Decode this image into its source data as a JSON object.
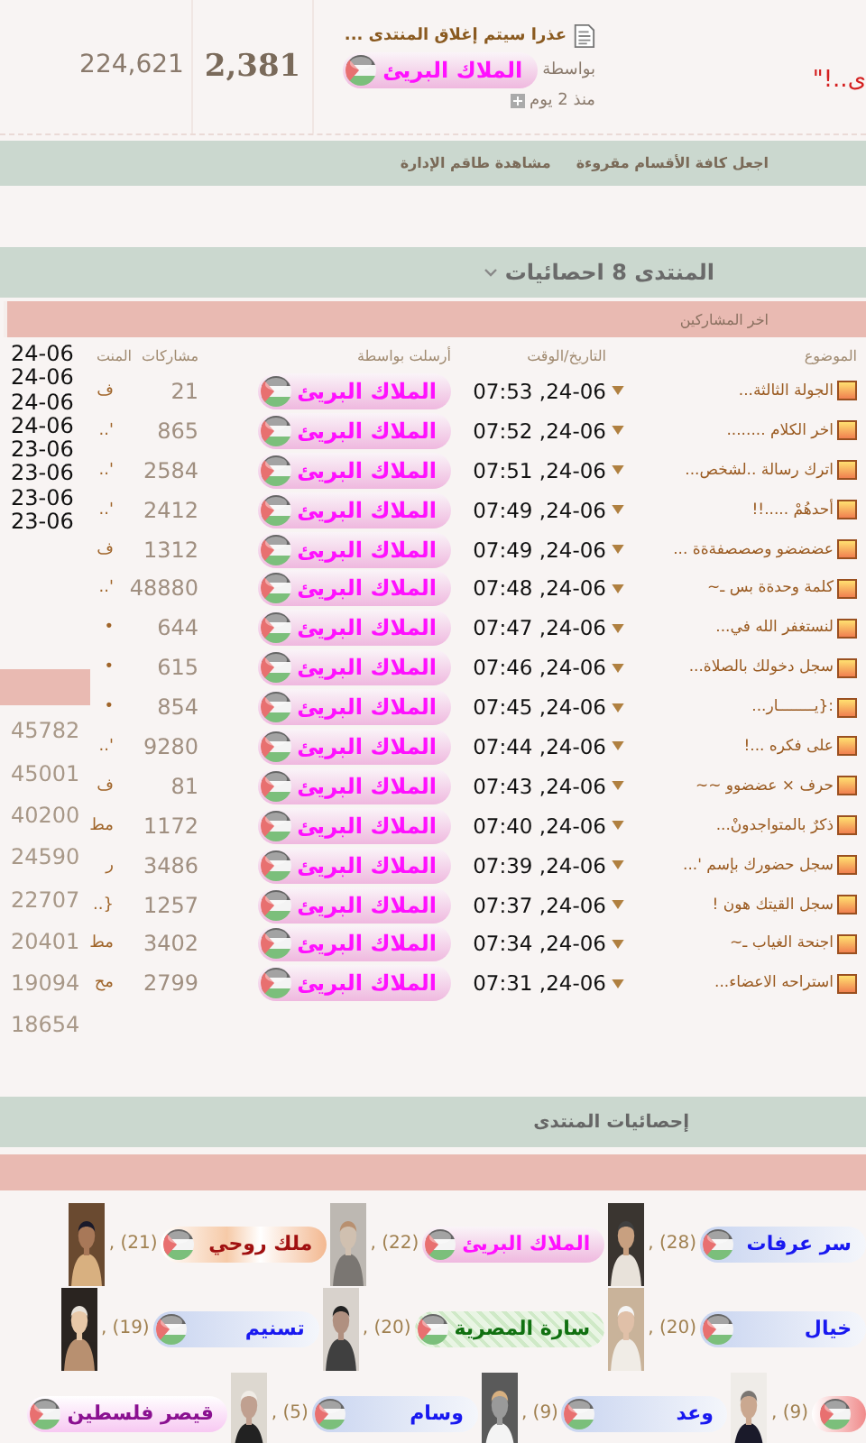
{
  "top": {
    "edge_text": "ى..!\"",
    "posts_total": "224,621",
    "topics_total": "2,381",
    "last_post": {
      "title": "عذرا سيتم إغلاق المنتدى ...",
      "by_label": "بواسطة",
      "user": "الملاك البريئ",
      "time": "منذ 2 يوم"
    }
  },
  "links": [
    "اجعل كافة الأقسام مقروءة",
    "مشاهدة طاقم الإدارة"
  ],
  "latest": {
    "title": "المنتدى 8 احصائيات",
    "subheader": "اخر المشاركين",
    "columns": [
      "الموضوع",
      "التاريخ/الوقت",
      "أرسلت بواسطة",
      "مشاركات",
      "المنت"
    ],
    "rows": [
      {
        "topic": "الجولة الثالثة...",
        "date": "24-06, 07:53",
        "user": "الملاك البريئ",
        "posts": "21",
        "column_5": "ف"
      },
      {
        "topic": "اخر الكلام ........",
        "date": "24-06, 07:52",
        "user": "الملاك البريئ",
        "posts": "865",
        "column_5": "'.."
      },
      {
        "topic": "اترك رسالة ..لشخص...",
        "date": "24-06, 07:51",
        "user": "الملاك البريئ",
        "posts": "2584",
        "column_5": "'.."
      },
      {
        "topic": "أحدهُمْ .....!!",
        "date": "24-06, 07:49",
        "user": "الملاك البريئ",
        "posts": "2412",
        "column_5": "'.."
      },
      {
        "topic": "عضضضو وصصصفةةة ...",
        "date": "24-06, 07:49",
        "user": "الملاك البريئ",
        "posts": "1312",
        "column_5": "ف"
      },
      {
        "topic": "كلمة وحدةة بس ـ~",
        "date": "24-06, 07:48",
        "user": "الملاك البريئ",
        "posts": "48880",
        "column_5": "'.."
      },
      {
        "topic": "لنستغفر الله في...",
        "date": "24-06, 07:47",
        "user": "الملاك البريئ",
        "posts": "644",
        "column_5": "•"
      },
      {
        "topic": "سجل دخولك بالصلاة...",
        "date": "24-06, 07:46",
        "user": "الملاك البريئ",
        "posts": "615",
        "column_5": "•"
      },
      {
        "topic": ":{يــــــــار...",
        "date": "24-06, 07:45",
        "user": "الملاك البريئ",
        "posts": "854",
        "column_5": "•"
      },
      {
        "topic": "على فكره ...!",
        "date": "24-06, 07:44",
        "user": "الملاك البريئ",
        "posts": "9280",
        "column_5": "'.."
      },
      {
        "topic": "حرف × عضضوو ~~",
        "date": "24-06, 07:43",
        "user": "الملاك البريئ",
        "posts": "81",
        "column_5": "ف"
      },
      {
        "topic": "ذكرٌ بالمتواجدونْ...",
        "date": "24-06, 07:40",
        "user": "الملاك البريئ",
        "posts": "1172",
        "column_5": "مط"
      },
      {
        "topic": "سجل حضورك بإسم '...",
        "date": "24-06, 07:39",
        "user": "الملاك البريئ",
        "posts": "3486",
        "column_5": "ر"
      },
      {
        "topic": "سجل القيتك هون !",
        "date": "24-06, 07:37",
        "user": "الملاك البريئ",
        "posts": "1257",
        "column_5": "{.."
      },
      {
        "topic": "اجنحة الغياب ـ~",
        "date": "24-06, 07:34",
        "user": "الملاك البريئ",
        "posts": "3402",
        "column_5": "مط"
      },
      {
        "topic": "استراحه الاعضاء...",
        "date": "24-06, 07:31",
        "user": "الملاك البريئ",
        "posts": "2799",
        "column_5": "مح"
      }
    ],
    "side_dates": [
      "24-06",
      "24-06",
      "24-06",
      "24-06",
      "23-06",
      "23-06",
      "23-06",
      "23-06"
    ],
    "side_numbers": [
      "45782",
      "45001",
      "40200",
      "24590",
      "22707",
      "20401",
      "19094",
      "18654"
    ]
  },
  "forum_stats": {
    "title": "إحصائيات المنتدى",
    "rows": [
      {
        "posters": [
          {
            "user": "سر عرفات",
            "kind": "blue",
            "count": ", (28)"
          },
          {
            "user": "الملاك البريئ",
            "kind": "pink",
            "count": ", (22)"
          },
          {
            "user": "ملك روحي",
            "kind": "orange",
            "count": ", (21)"
          }
        ]
      },
      {
        "posters": [
          {
            "user": "خيال",
            "kind": "blue",
            "count": ", (20)"
          },
          {
            "user": "سارة المصرية",
            "kind": "green",
            "count": ", (20)"
          },
          {
            "user": "تسنيم",
            "kind": "blue",
            "count": ", (19)"
          }
        ]
      },
      {
        "posters": [
          {
            "kind": "red",
            "count": ", (9)"
          },
          {
            "user": "وعد",
            "kind": "blue",
            "count": ", (9)"
          },
          {
            "user": "وسام",
            "kind": "blue",
            "count": ", (5)"
          },
          {
            "user": "قيصر فلسطين",
            "kind": "purple"
          }
        ]
      }
    ]
  }
}
